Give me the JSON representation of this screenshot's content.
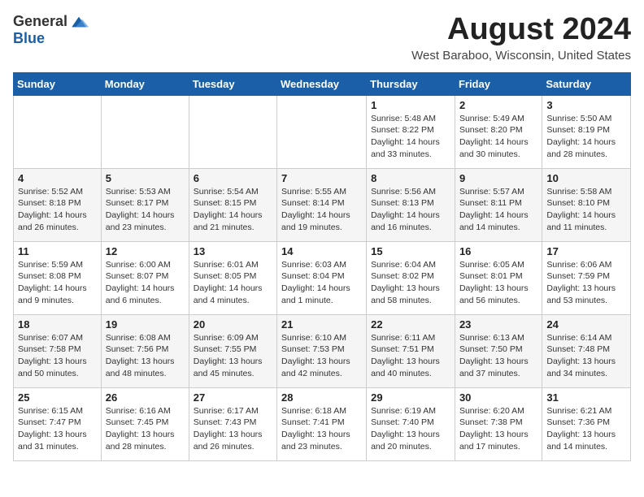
{
  "logo": {
    "general": "General",
    "blue": "Blue"
  },
  "title": {
    "month_year": "August 2024",
    "location": "West Baraboo, Wisconsin, United States"
  },
  "headers": [
    "Sunday",
    "Monday",
    "Tuesday",
    "Wednesday",
    "Thursday",
    "Friday",
    "Saturday"
  ],
  "weeks": [
    [
      {
        "day": "",
        "content": ""
      },
      {
        "day": "",
        "content": ""
      },
      {
        "day": "",
        "content": ""
      },
      {
        "day": "",
        "content": ""
      },
      {
        "day": "1",
        "content": "Sunrise: 5:48 AM\nSunset: 8:22 PM\nDaylight: 14 hours\nand 33 minutes."
      },
      {
        "day": "2",
        "content": "Sunrise: 5:49 AM\nSunset: 8:20 PM\nDaylight: 14 hours\nand 30 minutes."
      },
      {
        "day": "3",
        "content": "Sunrise: 5:50 AM\nSunset: 8:19 PM\nDaylight: 14 hours\nand 28 minutes."
      }
    ],
    [
      {
        "day": "4",
        "content": "Sunrise: 5:52 AM\nSunset: 8:18 PM\nDaylight: 14 hours\nand 26 minutes."
      },
      {
        "day": "5",
        "content": "Sunrise: 5:53 AM\nSunset: 8:17 PM\nDaylight: 14 hours\nand 23 minutes."
      },
      {
        "day": "6",
        "content": "Sunrise: 5:54 AM\nSunset: 8:15 PM\nDaylight: 14 hours\nand 21 minutes."
      },
      {
        "day": "7",
        "content": "Sunrise: 5:55 AM\nSunset: 8:14 PM\nDaylight: 14 hours\nand 19 minutes."
      },
      {
        "day": "8",
        "content": "Sunrise: 5:56 AM\nSunset: 8:13 PM\nDaylight: 14 hours\nand 16 minutes."
      },
      {
        "day": "9",
        "content": "Sunrise: 5:57 AM\nSunset: 8:11 PM\nDaylight: 14 hours\nand 14 minutes."
      },
      {
        "day": "10",
        "content": "Sunrise: 5:58 AM\nSunset: 8:10 PM\nDaylight: 14 hours\nand 11 minutes."
      }
    ],
    [
      {
        "day": "11",
        "content": "Sunrise: 5:59 AM\nSunset: 8:08 PM\nDaylight: 14 hours\nand 9 minutes."
      },
      {
        "day": "12",
        "content": "Sunrise: 6:00 AM\nSunset: 8:07 PM\nDaylight: 14 hours\nand 6 minutes."
      },
      {
        "day": "13",
        "content": "Sunrise: 6:01 AM\nSunset: 8:05 PM\nDaylight: 14 hours\nand 4 minutes."
      },
      {
        "day": "14",
        "content": "Sunrise: 6:03 AM\nSunset: 8:04 PM\nDaylight: 14 hours\nand 1 minute."
      },
      {
        "day": "15",
        "content": "Sunrise: 6:04 AM\nSunset: 8:02 PM\nDaylight: 13 hours\nand 58 minutes."
      },
      {
        "day": "16",
        "content": "Sunrise: 6:05 AM\nSunset: 8:01 PM\nDaylight: 13 hours\nand 56 minutes."
      },
      {
        "day": "17",
        "content": "Sunrise: 6:06 AM\nSunset: 7:59 PM\nDaylight: 13 hours\nand 53 minutes."
      }
    ],
    [
      {
        "day": "18",
        "content": "Sunrise: 6:07 AM\nSunset: 7:58 PM\nDaylight: 13 hours\nand 50 minutes."
      },
      {
        "day": "19",
        "content": "Sunrise: 6:08 AM\nSunset: 7:56 PM\nDaylight: 13 hours\nand 48 minutes."
      },
      {
        "day": "20",
        "content": "Sunrise: 6:09 AM\nSunset: 7:55 PM\nDaylight: 13 hours\nand 45 minutes."
      },
      {
        "day": "21",
        "content": "Sunrise: 6:10 AM\nSunset: 7:53 PM\nDaylight: 13 hours\nand 42 minutes."
      },
      {
        "day": "22",
        "content": "Sunrise: 6:11 AM\nSunset: 7:51 PM\nDaylight: 13 hours\nand 40 minutes."
      },
      {
        "day": "23",
        "content": "Sunrise: 6:13 AM\nSunset: 7:50 PM\nDaylight: 13 hours\nand 37 minutes."
      },
      {
        "day": "24",
        "content": "Sunrise: 6:14 AM\nSunset: 7:48 PM\nDaylight: 13 hours\nand 34 minutes."
      }
    ],
    [
      {
        "day": "25",
        "content": "Sunrise: 6:15 AM\nSunset: 7:47 PM\nDaylight: 13 hours\nand 31 minutes."
      },
      {
        "day": "26",
        "content": "Sunrise: 6:16 AM\nSunset: 7:45 PM\nDaylight: 13 hours\nand 28 minutes."
      },
      {
        "day": "27",
        "content": "Sunrise: 6:17 AM\nSunset: 7:43 PM\nDaylight: 13 hours\nand 26 minutes."
      },
      {
        "day": "28",
        "content": "Sunrise: 6:18 AM\nSunset: 7:41 PM\nDaylight: 13 hours\nand 23 minutes."
      },
      {
        "day": "29",
        "content": "Sunrise: 6:19 AM\nSunset: 7:40 PM\nDaylight: 13 hours\nand 20 minutes."
      },
      {
        "day": "30",
        "content": "Sunrise: 6:20 AM\nSunset: 7:38 PM\nDaylight: 13 hours\nand 17 minutes."
      },
      {
        "day": "31",
        "content": "Sunrise: 6:21 AM\nSunset: 7:36 PM\nDaylight: 13 hours\nand 14 minutes."
      }
    ]
  ]
}
